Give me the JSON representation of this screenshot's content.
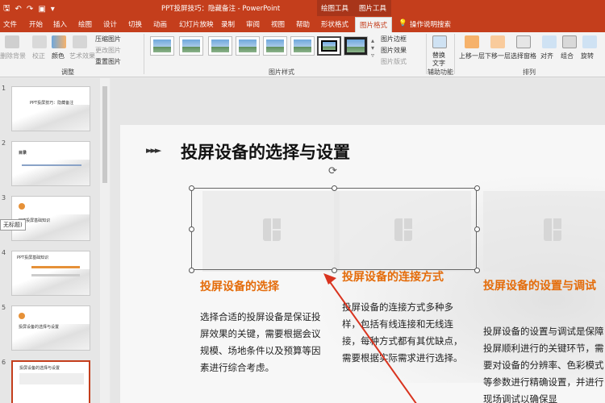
{
  "window": {
    "title": "PPT投屏技巧：隐藏备注 - PowerPoint",
    "ctx_drawing": "绘图工具",
    "ctx_picture": "图片工具"
  },
  "quick_access": [
    "save",
    "undo",
    "redo",
    "present"
  ],
  "tabs": [
    "文件",
    "开始",
    "插入",
    "绘图",
    "设计",
    "切换",
    "动画",
    "幻灯片放映",
    "录制",
    "审阅",
    "视图",
    "帮助",
    "形状格式",
    "图片格式",
    "操作说明搜索"
  ],
  "active_tab": "图片格式",
  "ribbon": {
    "remove_bg": "删除背景",
    "correct": "校正",
    "color": "颜色",
    "artistic": "艺术效果",
    "compress": "压缩图片",
    "change": "更改图片",
    "reset": "重置图片",
    "adjust_label": "调整",
    "styles_label": "图片样式",
    "border": "图片边框",
    "effects": "图片效果",
    "layout": "图片版式",
    "alt_text": "替换文字",
    "access_label": "辅助功能",
    "bring_fwd": "上移一层",
    "send_back": "下移一层",
    "sel_pane": "选择窗格",
    "align": "对齐",
    "group": "组合",
    "rotate": "旋转",
    "arrange_label": "排列"
  },
  "thumbnails": [
    {
      "num": "1",
      "text": "PPT投屏技巧：隐藏备注"
    },
    {
      "num": "2",
      "text": "目录"
    },
    {
      "num": "3",
      "text": "PPT投屏基础知识"
    },
    {
      "num": "4",
      "text": "PPT投屏基础知识"
    },
    {
      "num": "5",
      "text": "投屏设备的选择与设置"
    },
    {
      "num": "6",
      "text": "投屏设备的选择与设置"
    }
  ],
  "tooltip": "无标题)",
  "slide": {
    "title": "投屏设备的选择与设置",
    "columns": [
      {
        "heading": "投屏设备的选择",
        "body": "选择合适的投屏设备是保证投屏效果的关键，需要根据会议规模、场地条件以及预算等因素进行综合考虑。"
      },
      {
        "heading": "投屏设备的连接方式",
        "body": "投屏设备的连接方式多种多样，包括有线连接和无线连接，每种方式都有其优缺点，需要根据实际需求进行选择。"
      },
      {
        "heading": "投屏设备的设置与调试",
        "body": "投屏设备的设置与调试是保障投屏顺利进行的关键环节，需要对设备的分辨率、色彩模式等参数进行精确设置，并进行现场调试以确保显"
      }
    ]
  },
  "colors": {
    "accent": "#c43e1c",
    "heading_orange": "#e46c0a"
  }
}
